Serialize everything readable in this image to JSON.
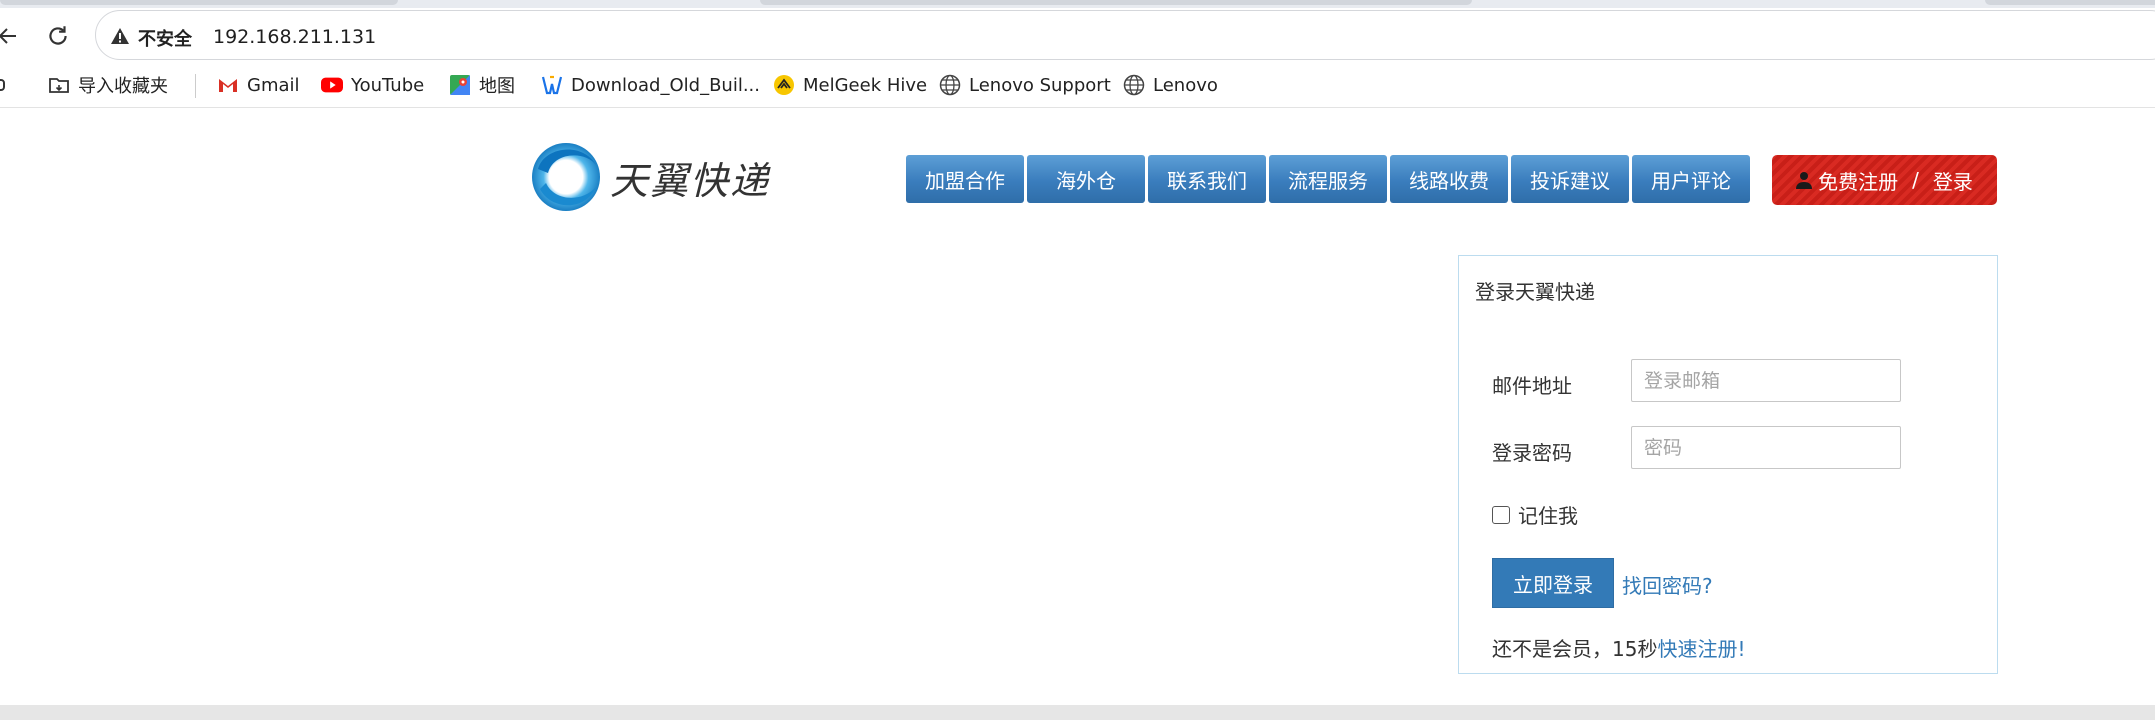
{
  "browser": {
    "security_label": "不安全",
    "url": "192.168.211.131",
    "bookmarks": [
      {
        "label": "导入收藏夹",
        "icon": "folder-import-icon"
      },
      {
        "label": "Gmail",
        "icon": "gmail-icon"
      },
      {
        "label": "YouTube",
        "icon": "youtube-icon"
      },
      {
        "label": "地图",
        "icon": "maps-icon"
      },
      {
        "label": "Download_Old_Buil...",
        "icon": "download-site-icon"
      },
      {
        "label": "MelGeek Hive",
        "icon": "melgeek-icon"
      },
      {
        "label": "Lenovo Support",
        "icon": "globe-icon"
      },
      {
        "label": "Lenovo",
        "icon": "globe-icon"
      }
    ]
  },
  "site": {
    "logo_text": "天翼快递",
    "nav": [
      "加盟合作",
      "海外仓",
      "联系我们",
      "流程服务",
      "线路收费",
      "投诉建议",
      "用户评论"
    ],
    "register_label": "免费注册",
    "slash": "/",
    "login_label": "登录",
    "colors": {
      "nav_blue": "#3a7dbd",
      "register_red": "#d92a22",
      "link_blue": "#337ab7"
    }
  },
  "login": {
    "title": "登录天翼快递",
    "email_label": "邮件地址",
    "email_placeholder": "登录邮箱",
    "password_label": "登录密码",
    "password_placeholder": "密码",
    "remember_label": "记住我",
    "submit_label": "立即登录",
    "forgot_label": "找回密码?",
    "signup_prefix": "还不是会员，",
    "signup_seconds": "15",
    "signup_unit": "秒",
    "signup_link": "快速注册!"
  }
}
